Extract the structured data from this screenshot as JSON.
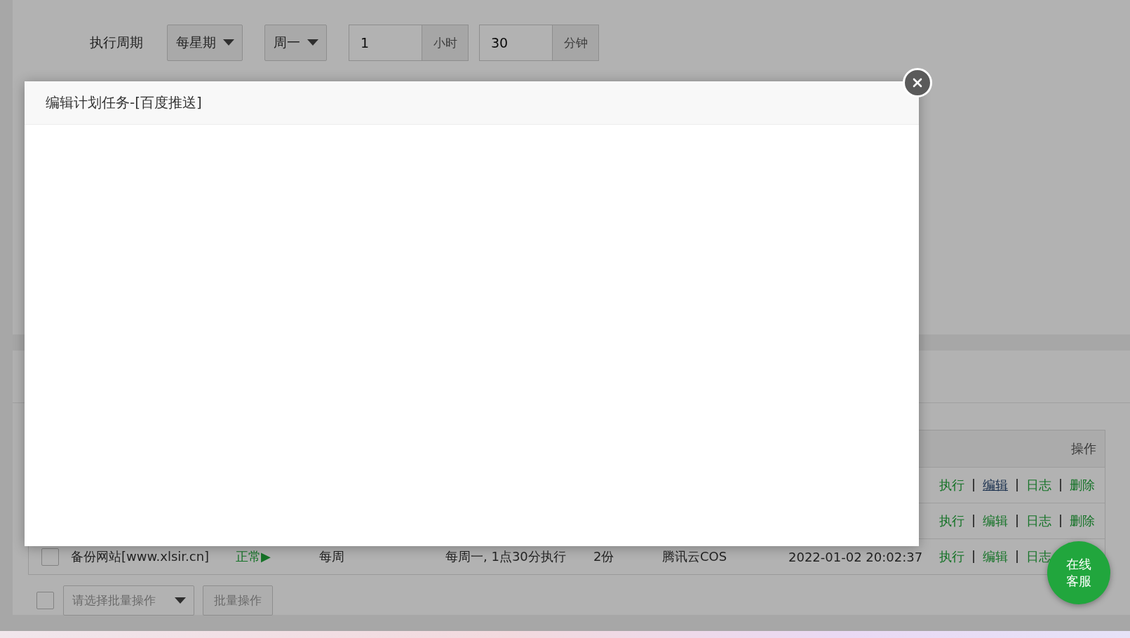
{
  "schedule": {
    "label": "执行周期",
    "selects": [
      {
        "value": "每星期"
      },
      {
        "value": "周一"
      }
    ],
    "inputs": [
      {
        "value": "1",
        "unit": "小时"
      },
      {
        "value": "30",
        "unit": "分钟"
      }
    ]
  },
  "dialog": {
    "title": "编辑计划任务-[百度推送]"
  },
  "table": {
    "columns": [
      {
        "label": "操作"
      }
    ],
    "rows": [
      {
        "actions": [
          {
            "label": "执行",
            "hovered": false
          },
          {
            "label": "编辑",
            "hovered": true
          },
          {
            "label": "日志",
            "hovered": false
          },
          {
            "label": "删除",
            "hovered": false
          }
        ]
      },
      {
        "actions": [
          {
            "label": "执行",
            "hovered": false
          },
          {
            "label": "编辑",
            "hovered": false
          },
          {
            "label": "日志",
            "hovered": false
          },
          {
            "label": "删除",
            "hovered": false
          }
        ]
      },
      {
        "checked": false,
        "name": "备份网站[www.xlsir.cn]",
        "status": "正常▶",
        "cycle": "每周",
        "description": "每周一, 1点30分执行",
        "copies": "2份",
        "storage": "腾讯云COS",
        "time": "2022-01-02 20:02:37",
        "actions": [
          {
            "label": "执行",
            "hovered": false
          },
          {
            "label": "编辑",
            "hovered": false
          },
          {
            "label": "日志",
            "hovered": false
          }
        ]
      }
    ]
  },
  "batch": {
    "checked": false,
    "placeholder": "请选择批量操作",
    "button": "批量操作"
  },
  "chat_button": {
    "label": "在线客服"
  }
}
